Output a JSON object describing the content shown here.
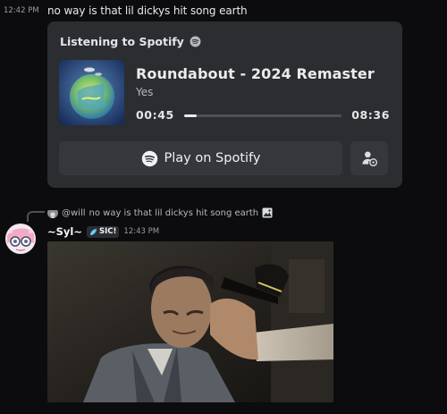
{
  "message1": {
    "timestamp": "12:42 PM",
    "text": "no way is that lil dickys hit song earth"
  },
  "spotify_card": {
    "header": "Listening to Spotify",
    "header_icon": "spotify-icon",
    "track_title": "Roundabout - 2024 Remaster",
    "artist": "Yes",
    "elapsed": "00:45",
    "total": "08:36",
    "progress_fraction": 0.08,
    "play_button_label": "Play on Spotify",
    "play_button_icon": "spotify-icon",
    "user_button_icon": "user-add-icon"
  },
  "reply": {
    "mention": "@will",
    "text": "no way is that lil dickys hit song earth",
    "attachment_icon": "image-icon"
  },
  "message2": {
    "author": "~Syl~",
    "clan_tag": "SIC!",
    "timestamp": "12:43 PM",
    "attachment": "gif"
  },
  "colors": {
    "background": "#0c0c0e",
    "card": "#2b2d31",
    "button": "#35373c",
    "text": "#dbdee1",
    "muted": "#9a9ba2"
  }
}
